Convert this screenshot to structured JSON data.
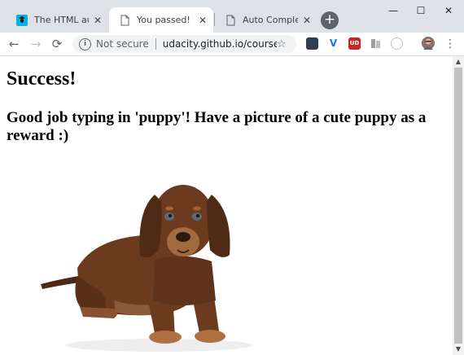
{
  "browser": {
    "tabs": [
      {
        "title": "The HTML autoco",
        "active": false
      },
      {
        "title": "You passed!",
        "active": true
      },
      {
        "title": "Auto Complete A",
        "active": false
      }
    ],
    "new_tab_symbol": "+",
    "window_controls": {
      "minimize": "—",
      "maximize": "☐",
      "close": "✕"
    },
    "toolbar": {
      "back": "←",
      "forward": "→",
      "reload": "⟳",
      "security_label": "Not secure",
      "url": "udacity.github.io/course-w...",
      "star": "☆",
      "menu": "⋮"
    },
    "extensions": [
      {
        "name": "pocket-icon",
        "color": "#2c3e50"
      },
      {
        "name": "vimeo-icon",
        "color": "#1a73e8"
      },
      {
        "name": "ublock-icon",
        "color": "#c62828",
        "text": "UD"
      },
      {
        "name": "reader-icon",
        "color": "#9e9e9e"
      },
      {
        "name": "circle-extension-icon",
        "color": "#e0e0e0"
      }
    ]
  },
  "page": {
    "heading": "Success!",
    "subheading": "Good job typing in 'puppy'! Have a picture of a cute puppy as a reward :)",
    "image_label": "cute-puppy-image"
  }
}
